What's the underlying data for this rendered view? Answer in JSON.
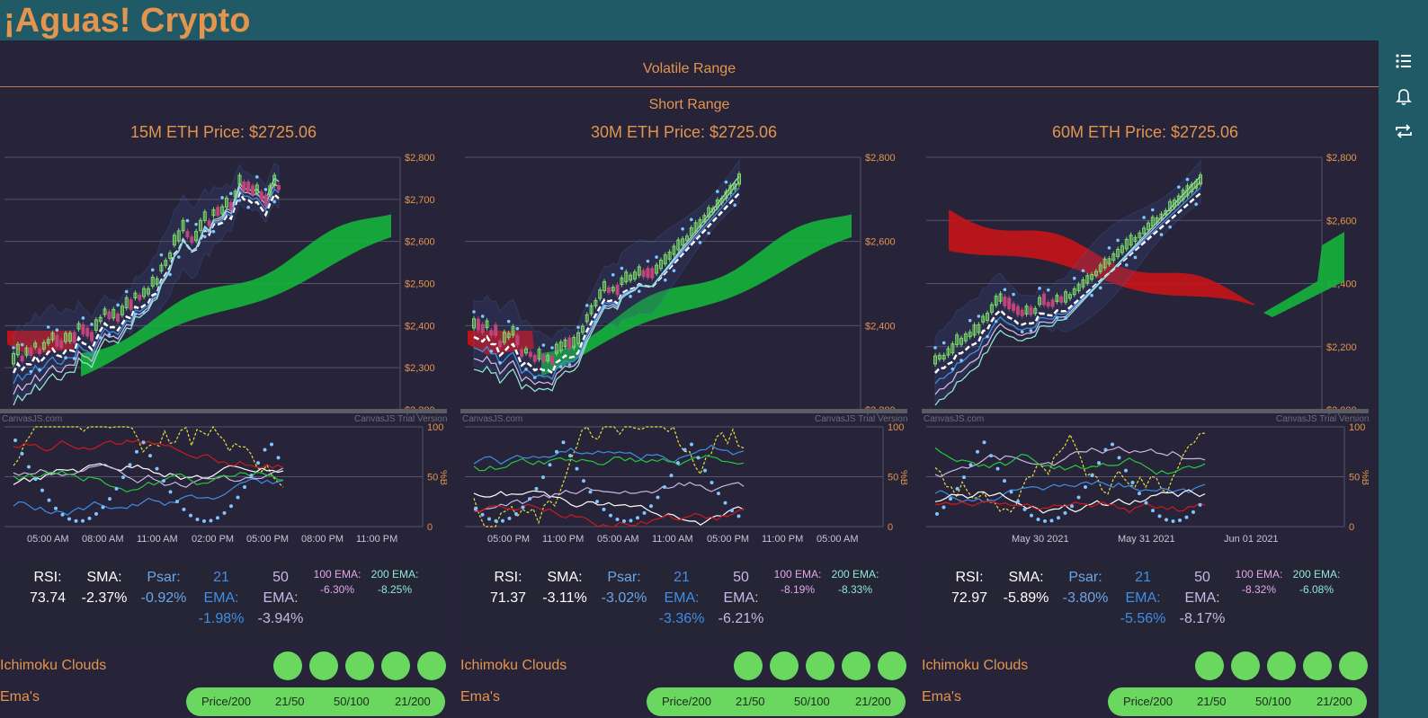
{
  "app": {
    "title": "¡Aguas! Crypto"
  },
  "rail": {
    "icons": [
      "list-icon",
      "bell-icon",
      "repeat-icon"
    ]
  },
  "sections": {
    "volatile": "Volatile Range",
    "short": "Short Range"
  },
  "colors": {
    "accent": "#e3954d",
    "good": "#6ad75e",
    "bg": "#272339",
    "bar": "#1f5a66"
  },
  "watermark": {
    "left": "CanvasJS.com",
    "right": "CanvasJS Trial Version"
  },
  "panels": [
    {
      "title": "15M ETH Price: $2725.06",
      "price_ticks": [
        "$2,800",
        "$2,700",
        "$2,600",
        "$2,500",
        "$2,400",
        "$2,300",
        "$2,200"
      ],
      "osc_ticks": [
        "100",
        "50",
        "0"
      ],
      "osc_axis": "%B",
      "x_ticks": [
        "05:00 AM",
        "08:00 AM",
        "11:00 AM",
        "02:00 PM",
        "05:00 PM",
        "08:00 PM",
        "11:00 PM"
      ],
      "rsi": {
        "label": "RSI:",
        "value": "73.74"
      },
      "sma": {
        "label": "SMA:",
        "value": "-2.37%"
      },
      "psar": {
        "label": "Psar:",
        "value": "-0.92%"
      },
      "ema21": {
        "label1": "21",
        "label2": "EMA:",
        "value": "-1.98%"
      },
      "ema50": {
        "label1": "50",
        "label2": "EMA:",
        "value": "-3.94%"
      },
      "ema100": {
        "label": "100 EMA:",
        "value": "-6.30%"
      },
      "ema200": {
        "label": "200 EMA:",
        "value": "-8.25%"
      },
      "ichimoku": "Ichimoku Clouds",
      "emas": "Ema's",
      "ema_pills": [
        "Price/200",
        "21/50",
        "50/100",
        "21/200"
      ]
    },
    {
      "title": "30M ETH Price: $2725.06",
      "price_ticks": [
        "$2,800",
        "$2,600",
        "$2,400",
        "$2,200"
      ],
      "osc_ticks": [
        "100",
        "50",
        "0"
      ],
      "osc_axis": "%B",
      "x_ticks": [
        "05:00 PM",
        "11:00 PM",
        "05:00 AM",
        "11:00 AM",
        "05:00 PM",
        "11:00 PM",
        "05:00 AM"
      ],
      "rsi": {
        "label": "RSI:",
        "value": "71.37"
      },
      "sma": {
        "label": "SMA:",
        "value": "-3.11%"
      },
      "psar": {
        "label": "Psar:",
        "value": "-3.02%"
      },
      "ema21": {
        "label1": "21",
        "label2": "EMA:",
        "value": "-3.36%"
      },
      "ema50": {
        "label1": "50",
        "label2": "EMA:",
        "value": "-6.21%"
      },
      "ema100": {
        "label": "100 EMA:",
        "value": "-8.19%"
      },
      "ema200": {
        "label": "200 EMA:",
        "value": "-8.33%"
      },
      "ichimoku": "Ichimoku Clouds",
      "emas": "Ema's",
      "ema_pills": [
        "Price/200",
        "21/50",
        "50/100",
        "21/200"
      ]
    },
    {
      "title": "60M ETH Price: $2725.06",
      "price_ticks": [
        "$2,800",
        "$2,600",
        "$2,400",
        "$2,200",
        "$2,000"
      ],
      "osc_ticks": [
        "100",
        "50",
        "0"
      ],
      "osc_axis": "%B",
      "x_ticks": [
        "May 30 2021",
        "May 31 2021",
        "Jun 01 2021"
      ],
      "rsi": {
        "label": "RSI:",
        "value": "72.97"
      },
      "sma": {
        "label": "SMA:",
        "value": "-5.89%"
      },
      "psar": {
        "label": "Psar:",
        "value": "-3.80%"
      },
      "ema21": {
        "label1": "21",
        "label2": "EMA:",
        "value": "-5.56%"
      },
      "ema50": {
        "label1": "50",
        "label2": "EMA:",
        "value": "-8.17%"
      },
      "ema100": {
        "label": "100 EMA:",
        "value": "-8.32%"
      },
      "ema200": {
        "label": "200 EMA:",
        "value": "-6.08%"
      },
      "ichimoku": "Ichimoku Clouds",
      "emas": "Ema's",
      "ema_pills": [
        "Price/200",
        "21/50",
        "50/100",
        "21/200"
      ]
    }
  ]
}
